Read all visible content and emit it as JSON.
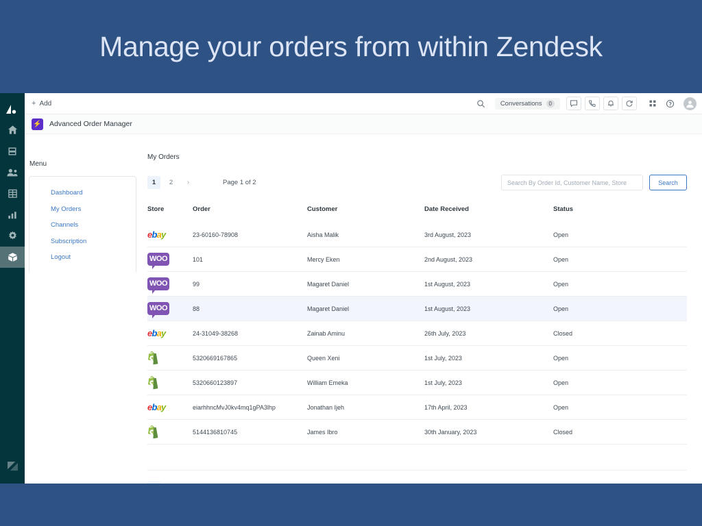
{
  "banner": {
    "title": "Manage your orders from within Zendesk"
  },
  "rail": {
    "items": [
      {
        "name": "zendesk-logo",
        "icon": "zendesk-mark"
      },
      {
        "name": "home",
        "icon": "home-icon"
      },
      {
        "name": "views",
        "icon": "views-icon"
      },
      {
        "name": "customers",
        "icon": "customers-icon"
      },
      {
        "name": "organizations",
        "icon": "organizations-icon"
      },
      {
        "name": "reporting",
        "icon": "chart-icon"
      },
      {
        "name": "admin",
        "icon": "gear-icon"
      },
      {
        "name": "apps",
        "icon": "box-icon",
        "active": true
      }
    ],
    "bottom_icon": "zendesk-wordmark"
  },
  "topbar": {
    "add_label": "Add",
    "add_icon": "plus-icon",
    "search_icon": "search-icon",
    "conversations_label": "Conversations",
    "conversations_count": "0",
    "icons": [
      "chat-icon",
      "phone-icon",
      "bell-icon",
      "refresh-icon",
      "grid-icon",
      "help-icon"
    ],
    "avatar_icon": "user-avatar"
  },
  "app_header": {
    "logo_glyph": "⚡",
    "title": "Advanced Order Manager"
  },
  "menu": {
    "label": "Menu",
    "items": [
      {
        "label": "Dashboard"
      },
      {
        "label": "My Orders"
      },
      {
        "label": "Channels"
      },
      {
        "label": "Subscription"
      },
      {
        "label": "Logout"
      }
    ]
  },
  "content": {
    "title": "My Orders",
    "pagination": {
      "pages": [
        "1",
        "2"
      ],
      "next_icon": "chevron-right-icon",
      "active_page": "1",
      "page_text": "Page 1 of 2"
    },
    "search": {
      "placeholder": "Search By Order Id, Customer Name, Store",
      "value": "",
      "button_label": "Search"
    },
    "table": {
      "columns": [
        "Store",
        "Order",
        "Customer",
        "Date Received",
        "Status"
      ],
      "rows": [
        {
          "store": "ebay",
          "order": "23-60160-78908",
          "customer": "Aisha Malik",
          "date": "3rd August, 2023",
          "status": "Open",
          "highlight": false
        },
        {
          "store": "woo",
          "order": "101",
          "customer": "Mercy Eken",
          "date": "2nd August, 2023",
          "status": "Open",
          "highlight": false
        },
        {
          "store": "woo",
          "order": "99",
          "customer": "Magaret Daniel",
          "date": "1st August, 2023",
          "status": "Open",
          "highlight": false
        },
        {
          "store": "woo",
          "order": "88",
          "customer": "Magaret Daniel",
          "date": "1st August, 2023",
          "status": "Open",
          "highlight": true
        },
        {
          "store": "ebay",
          "order": "24-31049-38268",
          "customer": "Zainab Aminu",
          "date": "26th July, 2023",
          "status": "Closed",
          "highlight": false
        },
        {
          "store": "shopify",
          "order": "5320669167865",
          "customer": "Queen Xeni",
          "date": "1st July, 2023",
          "status": "Open",
          "highlight": false
        },
        {
          "store": "shopify",
          "order": "5320660123897",
          "customer": "William Emeka",
          "date": "1st July, 2023",
          "status": "Open",
          "highlight": false
        },
        {
          "store": "ebay",
          "order": "eiarhhncMvJ0kv4mq1gPA3lhp",
          "customer": "Jonathan Ijeh",
          "date": "17th April, 2023",
          "status": "Open",
          "highlight": false
        },
        {
          "store": "shopify",
          "order": "5144136810745",
          "customer": "James Ibro",
          "date": "30th January, 2023",
          "status": "Closed",
          "highlight": false
        }
      ]
    }
  },
  "colors": {
    "banner_background": "#2e5284",
    "banner_text": "#dde5f5",
    "rail_background": "#04343c",
    "rail_active": "#557277",
    "link": "#3b77c4",
    "row_highlight": "#f2f5fb",
    "app_logo": "#5b2ecc",
    "ebay_red": "#e53238",
    "ebay_blue": "#0064d2",
    "ebay_yellow": "#f5af02",
    "ebay_green": "#86b817",
    "woo_purple": "#7f54b3",
    "shopify_green": "#95bf47"
  }
}
